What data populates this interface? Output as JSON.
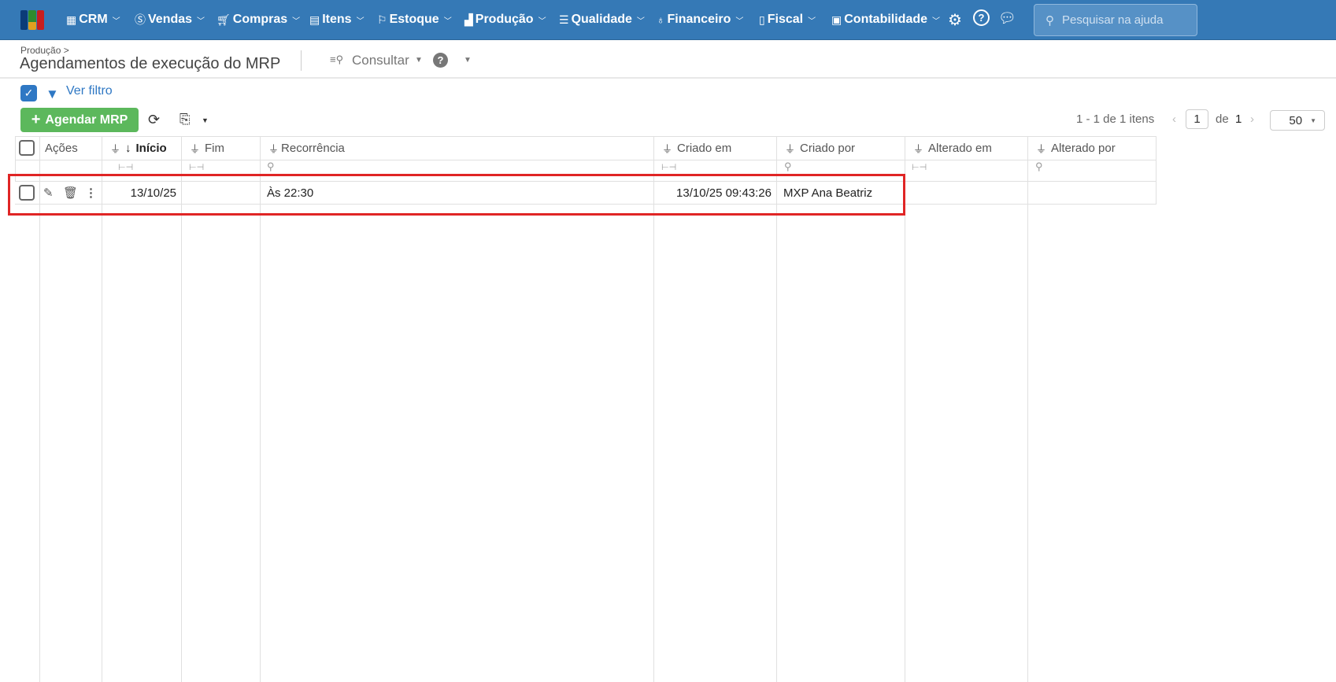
{
  "nav": {
    "items": [
      {
        "label": "CRM",
        "icon": "building-icon"
      },
      {
        "label": "Vendas",
        "icon": "dollar-icon"
      },
      {
        "label": "Compras",
        "icon": "cart-icon"
      },
      {
        "label": "Itens",
        "icon": "items-icon"
      },
      {
        "label": "Estoque",
        "icon": "dolly-icon"
      },
      {
        "label": "Produção",
        "icon": "factory-icon"
      },
      {
        "label": "Qualidade",
        "icon": "checklist-icon"
      },
      {
        "label": "Financeiro",
        "icon": "money-bag-icon"
      },
      {
        "label": "Fiscal",
        "icon": "document-icon"
      },
      {
        "label": "Contabilidade",
        "icon": "calculator-icon"
      }
    ],
    "search_placeholder": "Pesquisar na ajuda"
  },
  "header": {
    "breadcrumb": "Produção >",
    "title": "Agendamentos de execução do MRP",
    "consultar": "Consultar"
  },
  "toolbar": {
    "ver_filtro": "Ver filtro",
    "add_button": "Agendar MRP"
  },
  "pagination": {
    "summary": "1 - 1 de 1 itens",
    "page": "1",
    "of_label": "de",
    "total_pages": "1",
    "page_size": "50"
  },
  "table": {
    "columns": [
      "Ações",
      "Início",
      "Fim",
      "Recorrência",
      "Criado em",
      "Criado por",
      "Alterado em",
      "Alterado por"
    ],
    "rows": [
      {
        "inicio": "13/10/25",
        "fim": "",
        "recorrencia": "Às 22:30",
        "criado_em": "13/10/25 09:43:26",
        "criado_por": "MXP Ana Beatriz",
        "alterado_em": "",
        "alterado_por": ""
      }
    ]
  },
  "colors": {
    "nav": "#3579b6",
    "accent": "#5cb85c",
    "highlight": "#e02525"
  }
}
